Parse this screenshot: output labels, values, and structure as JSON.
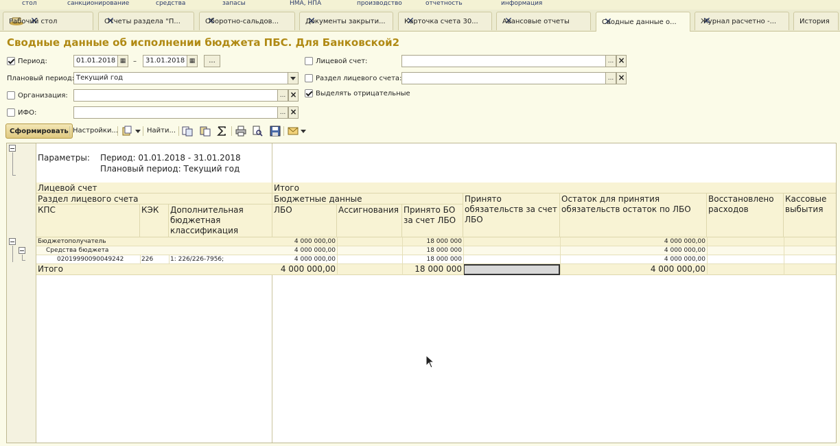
{
  "top_menu": [
    "стол",
    "санкционирование",
    "средства",
    "запасы",
    "НМА, НПА",
    "производство",
    "отчетность",
    "информация"
  ],
  "tabs": [
    {
      "label": "Рабочий стол",
      "close": true,
      "active": false
    },
    {
      "label": "Отчеты раздела \"П...",
      "close": true,
      "active": false
    },
    {
      "label": "Оборотно-сальдов...",
      "close": true,
      "active": false
    },
    {
      "label": "Документы закрыти...",
      "close": true,
      "active": false
    },
    {
      "label": "Карточка счета 30...",
      "close": true,
      "active": false
    },
    {
      "label": "Авансовые отчеты",
      "close": true,
      "active": false
    },
    {
      "label": "Сводные данные о...",
      "close": true,
      "active": true
    },
    {
      "label": "Журнал расчетно -...",
      "close": true,
      "active": false
    },
    {
      "label": "История",
      "close": false,
      "active": false
    }
  ],
  "page_title": "Сводные данные об исполнении бюджета ПБС. Для Банковской2",
  "form": {
    "period_label": "Период:",
    "period_checked": true,
    "date_from": "01.01.2018",
    "dash": "–",
    "date_to": "31.01.2018",
    "ellipsis_btn": "...",
    "plan_period_label": "Плановый период:",
    "plan_period_value": "Текущий год",
    "org_label": "Организация:",
    "org_checked": false,
    "org_value": "",
    "ifo_label": "ИФО:",
    "ifo_checked": false,
    "ifo_value": "",
    "account_label": "Лицевой счет:",
    "account_checked": false,
    "account_value": "",
    "section_label": "Раздел лицевого счета:",
    "section_checked": false,
    "section_value": "",
    "negative_label": "Выделять отрицательные",
    "negative_checked": true
  },
  "toolbar": {
    "generate": "Сформировать",
    "settings": "Настройки...",
    "find": "Найти..."
  },
  "report": {
    "params_label": "Параметры:",
    "params_period": "Период: 01.01.2018 - 31.01.2018",
    "params_plan": "Плановый период: Текущий год",
    "h_account": "Лицевой счет",
    "h_itogo": "Итого",
    "h_section": "Раздел лицевого счета",
    "h_budget_data": "Бюджетные данные",
    "h_accepted_obl": "Принято обязательств за счет ЛБО",
    "h_remaining": "Остаток для принятия обязательств остаток по ЛБО",
    "h_restored": "Восстановлено расходов",
    "h_cash": "Кассовые выбытия",
    "h_kps": "КПС",
    "h_kek": "КЭК",
    "h_addclass": "Дополнительная бюджетная классификация",
    "h_lbo": "ЛБО",
    "h_assign": "Ассигнования",
    "h_accepted_bo": "Принято БО за счет ЛБО",
    "rows": [
      {
        "name": "Бюджетополучатель",
        "kek": "",
        "add": "",
        "lbo": "4 000 000,00",
        "assign": "",
        "bo": "18 000 000",
        "obl": "",
        "rem": "4 000 000,00",
        "rest": "",
        "cash": ""
      },
      {
        "name": "Средства бюджета",
        "kek": "",
        "add": "",
        "lbo": "4 000 000,00",
        "assign": "",
        "bo": "18 000 000",
        "obl": "",
        "rem": "4 000 000,00",
        "rest": "",
        "cash": ""
      },
      {
        "name": "02019990090049242",
        "kek": "226",
        "add": "1: 226/226-7956;",
        "lbo": "4 000 000,00",
        "assign": "",
        "bo": "18 000 000",
        "obl": "",
        "rem": "4 000 000,00",
        "rest": "",
        "cash": ""
      }
    ],
    "total": {
      "name": "Итого",
      "lbo": "4 000 000,00",
      "bo": "18 000 000",
      "rem": "4 000 000,00"
    }
  },
  "icons": {
    "home": "desk-icon",
    "close": "close-icon",
    "calendar": "calendar-icon",
    "sum": "sigma-icon",
    "print": "printer-icon",
    "preview": "preview-icon",
    "save": "save-icon",
    "mail": "mail-icon"
  },
  "colors": {
    "title": "#b08a14",
    "header_bg": "#f8f3d4",
    "bg": "#fbfbe8"
  }
}
